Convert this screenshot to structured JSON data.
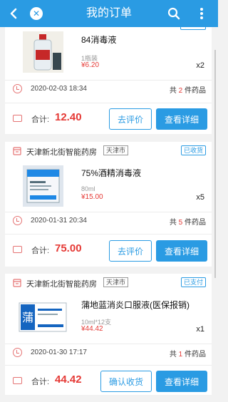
{
  "header": {
    "title": "我的订单"
  },
  "orders": [
    {
      "product": "84消毒液",
      "spec": "1瓶装",
      "price": "¥6.20",
      "qty": "x2",
      "time": "2020-02-03 18:34",
      "count_pre": "共",
      "count_num": "2",
      "count_post": "件药品",
      "total_label": "合计:",
      "total": "12.40",
      "btn1": "去评价",
      "btn2": "查看详细"
    },
    {
      "store": "天津新北街智能药房",
      "city": "天津市",
      "status": "已收货",
      "product": "75%酒精消毒液",
      "spec": "80ml",
      "price": "¥15.00",
      "qty": "x5",
      "time": "2020-01-31 20:34",
      "count_pre": "共",
      "count_num": "5",
      "count_post": "件药品",
      "total_label": "合计:",
      "total": "75.00",
      "btn1": "去评价",
      "btn2": "查看详细"
    },
    {
      "store": "天津新北街智能药房",
      "city": "天津市",
      "status": "已支付",
      "product": "蒲地蓝消炎口服液(医保报销)",
      "spec": "10ml*12支",
      "price": "¥44.42",
      "qty": "x1",
      "time": "2020-01-30 17:17",
      "count_pre": "共",
      "count_num": "1",
      "count_post": "件药品",
      "total_label": "合计:",
      "total": "44.42",
      "btn1": "确认收货",
      "btn2": "查看详细"
    }
  ],
  "colors": {
    "accent": "#2a9be3",
    "price": "#e53935",
    "icon": "#e57373"
  }
}
